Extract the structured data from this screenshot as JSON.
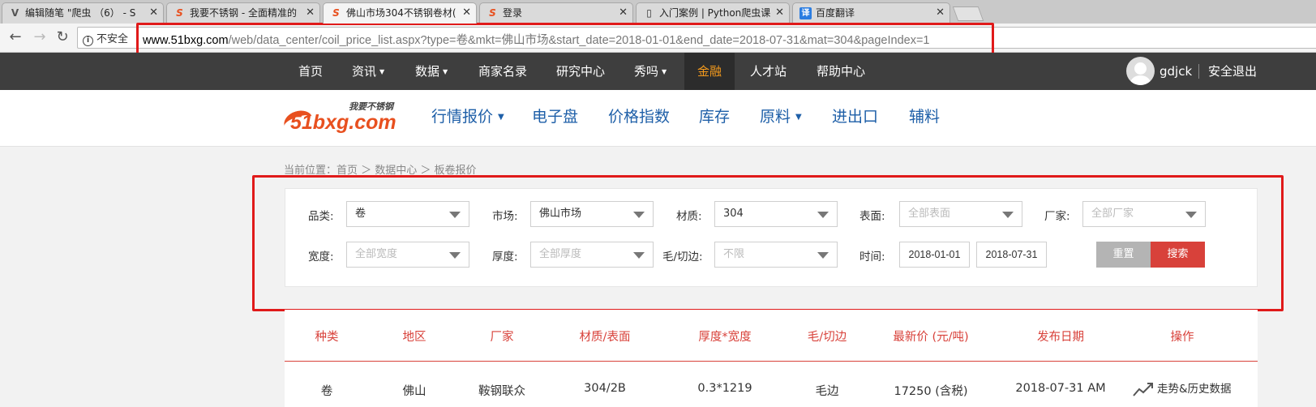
{
  "browser": {
    "tabs": [
      {
        "title": "编辑随笔 \"爬虫 （6） - S",
        "icon": "blog-edit-icon"
      },
      {
        "title": "我要不锈钢 - 全面精准的",
        "icon": "51bxg-favicon"
      },
      {
        "title": "佛山市场304不锈钢卷材(",
        "icon": "51bxg-favicon"
      },
      {
        "title": "登录",
        "icon": "51bxg-favicon"
      },
      {
        "title": "入门案例 | Python爬虫课",
        "icon": "book-icon"
      },
      {
        "title": "百度翻译",
        "icon": "baidu-translate-icon"
      }
    ],
    "close_glyph": "✕",
    "security_label": "不安全",
    "url_host": "www.51bxg.com",
    "url_path": "/web/data_center/coil_price_list.aspx?type=卷&mkt=佛山市场&start_date=2018-01-01&end_date=2018-07-31&mat=304&pageIndex=1",
    "translate_glyph": "译"
  },
  "topnav": {
    "items": [
      {
        "label": "首页"
      },
      {
        "label": "资讯"
      },
      {
        "label": "数据"
      },
      {
        "label": "商家名录"
      },
      {
        "label": "研究中心"
      },
      {
        "label": "秀吗"
      },
      {
        "label": "金融"
      },
      {
        "label": "人才站"
      },
      {
        "label": "帮助中心"
      }
    ],
    "username": "gdjck",
    "logout": "安全退出"
  },
  "header": {
    "logo_slogan": "我要不锈钢",
    "logo_brand": "51bxg.com",
    "nav": [
      {
        "label": "行情报价"
      },
      {
        "label": "电子盘"
      },
      {
        "label": "价格指数"
      },
      {
        "label": "库存"
      },
      {
        "label": "原料"
      },
      {
        "label": "进出口"
      },
      {
        "label": "辅料"
      }
    ]
  },
  "breadcrumb": "当前位置：首页 ＞ 数据中心 ＞ 板卷报价",
  "filters": {
    "category": {
      "label": "品类:",
      "value": "卷"
    },
    "market": {
      "label": "市场:",
      "value": "佛山市场"
    },
    "material": {
      "label": "材质:",
      "value": "304"
    },
    "surface": {
      "label": "表面:",
      "placeholder": "全部表面"
    },
    "manufacturer": {
      "label": "厂家:",
      "placeholder": "全部厂家"
    },
    "width": {
      "label": "宽度:",
      "placeholder": "全部宽度"
    },
    "thickness": {
      "label": "厚度:",
      "placeholder": "全部厚度"
    },
    "edge": {
      "label": "毛/切边:",
      "placeholder": "不限"
    },
    "time": {
      "label": "时间:",
      "start": "2018-01-01",
      "end": "2018-07-31"
    },
    "reset_label": "重置",
    "search_label": "搜索"
  },
  "table": {
    "headers": [
      "种类",
      "地区",
      "厂家",
      "材质/表面",
      "厚度*宽度",
      "毛/切边",
      "最新价 (元/吨)",
      "发布日期",
      "操作"
    ],
    "rows": [
      [
        "卷",
        "佛山",
        "鞍钢联众",
        "304/2B",
        "0.3*1219",
        "毛边",
        "17250 (含税)",
        "2018-07-31 AM",
        "走势&历史数据"
      ]
    ]
  },
  "colors": {
    "highlight": "#e01a1a",
    "accent": "#d8413a",
    "nav_active": "#f39a1d",
    "link_blue": "#1e5fa8"
  }
}
